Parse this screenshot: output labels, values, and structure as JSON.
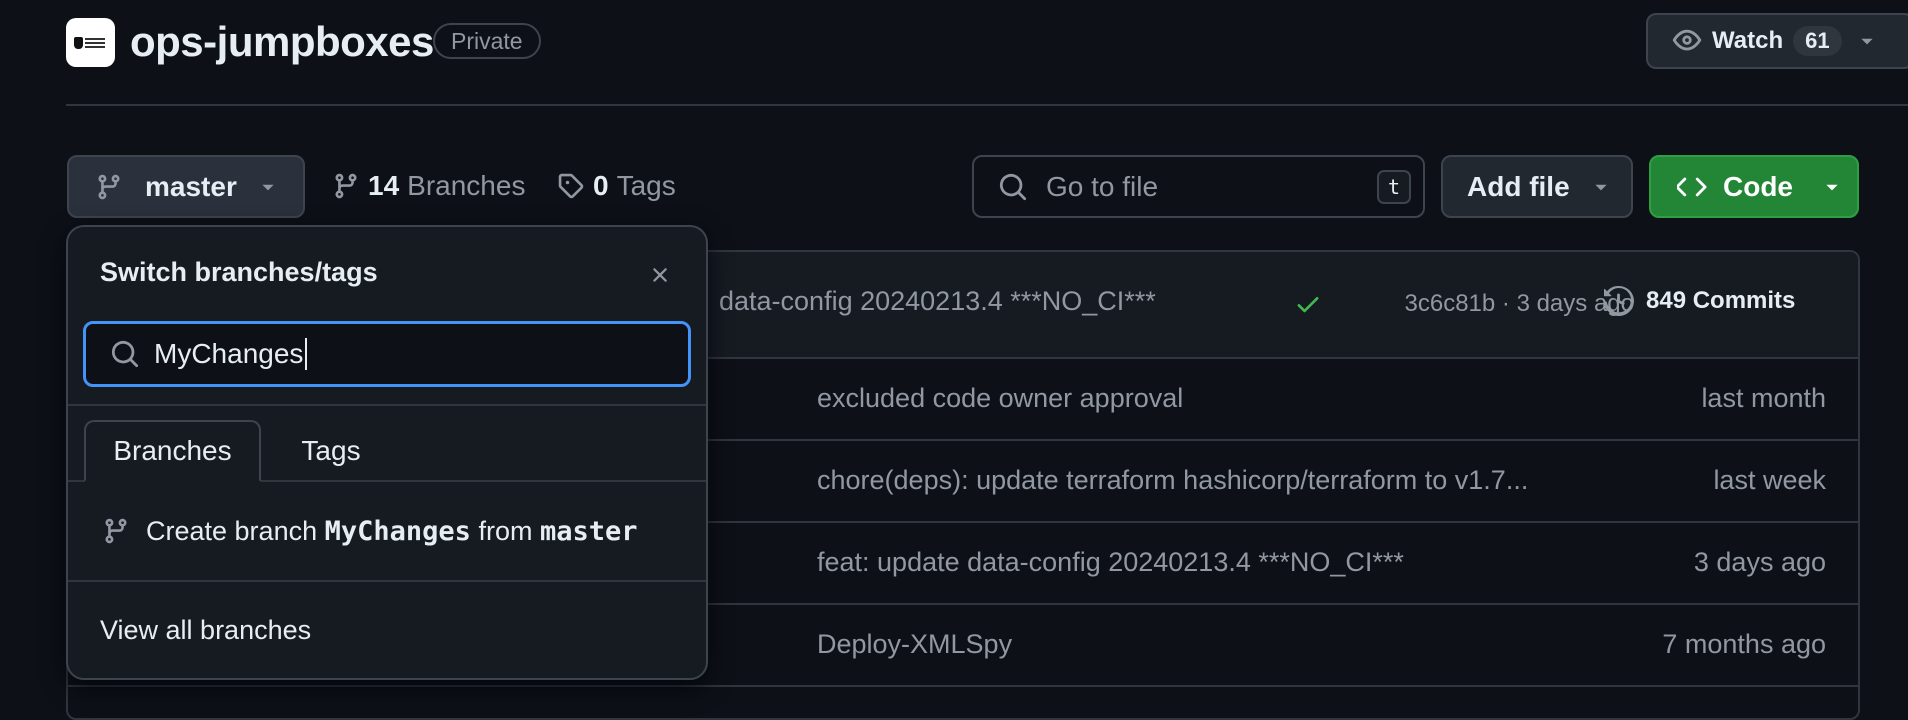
{
  "repo": {
    "name": "ops-jumpboxes",
    "visibility": "Private",
    "logo": "org-logo"
  },
  "watch": {
    "label": "Watch",
    "count": "61"
  },
  "toolbar": {
    "branch": "master",
    "branches_count": "14",
    "branches_label": "Branches",
    "tags_count": "0",
    "tags_label": "Tags",
    "go_to_file_placeholder": "Go to file",
    "go_to_file_shortcut": "t",
    "add_file_label": "Add file",
    "code_label": "Code"
  },
  "latest_commit": {
    "message": "data-config 20240213.4 ***NO_CI***",
    "status": "success",
    "meta": "3c6c81b · 3 days ago",
    "commits_label": "849 Commits"
  },
  "files": [
    {
      "message": "excluded code owner approval",
      "time": "last month"
    },
    {
      "message": "chore(deps): update terraform hashicorp/terraform to v1.7...",
      "time": "last week"
    },
    {
      "message": "feat: update data-config 20240213.4 ***NO_CI***",
      "time": "3 days ago"
    },
    {
      "message": "Deploy-XMLSpy",
      "time": "7 months ago"
    }
  ],
  "dropdown": {
    "title": "Switch branches/tags",
    "search_value": "MyChanges",
    "tabs": [
      "Branches",
      "Tags"
    ],
    "create_prefix": "Create branch",
    "create_branch_name": "MyChanges",
    "create_from": "from",
    "create_source": "master",
    "view_all": "View all branches"
  },
  "colors": {
    "background": "#0d1117",
    "accent": "#4493f8",
    "success": "#3fb950",
    "code_button": "#238636"
  }
}
